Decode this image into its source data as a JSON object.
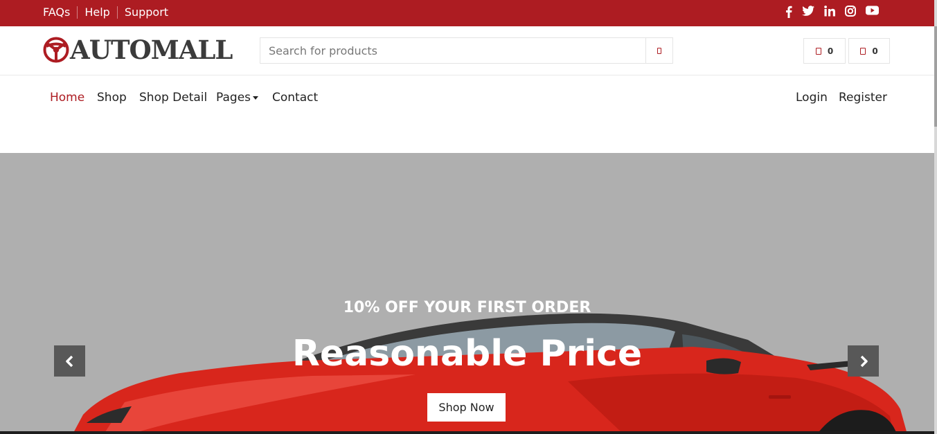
{
  "topbar": {
    "links": [
      "FAQs",
      "Help",
      "Support"
    ],
    "social_icons": [
      "facebook-icon",
      "twitter-icon",
      "linkedin-icon",
      "instagram-icon",
      "youtube-icon"
    ]
  },
  "header": {
    "logo_text": "AUTOMALL",
    "search_placeholder": "Search for products",
    "wishlist_count": "0",
    "cart_count": "0"
  },
  "nav": {
    "items": [
      "Home",
      "Shop",
      "Shop Detail",
      "Pages",
      "Contact"
    ],
    "active": "Home",
    "right": [
      "Login",
      "Register"
    ]
  },
  "hero": {
    "subtitle": "10% OFF YOUR FIRST ORDER",
    "title": "Reasonable Price",
    "button": "Shop Now"
  },
  "colors": {
    "brand": "#ad1c22",
    "hero_bg": "#afafaf",
    "car": "#d8261c"
  }
}
